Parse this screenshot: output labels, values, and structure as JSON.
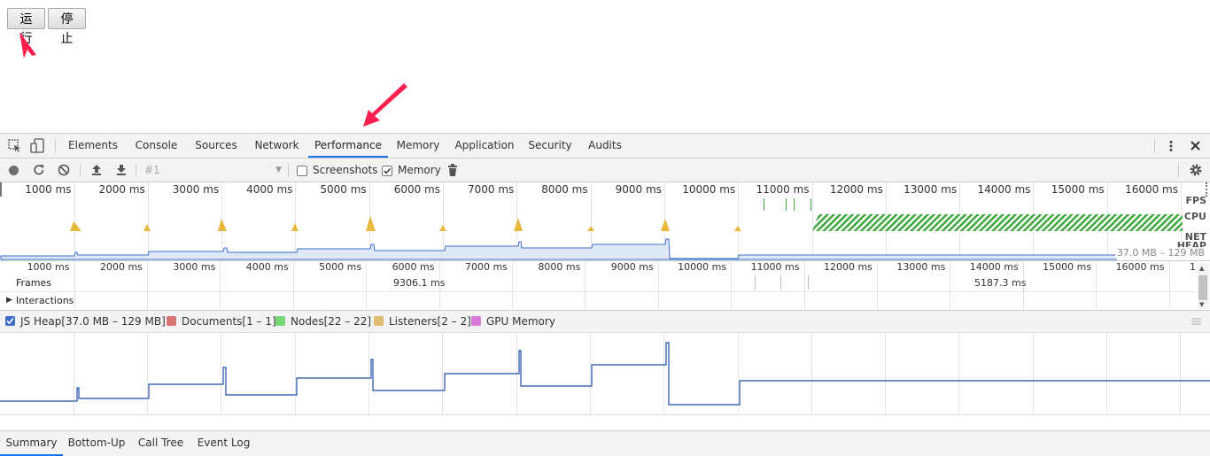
{
  "page": {
    "run_button": "运行",
    "stop_button": "停止"
  },
  "devtools": {
    "tabs": [
      "Elements",
      "Console",
      "Sources",
      "Network",
      "Performance",
      "Memory",
      "Application",
      "Security",
      "Audits"
    ],
    "active_tab": "Performance"
  },
  "toolbar": {
    "profile_select": "#1",
    "screenshots_label": "Screenshots",
    "screenshots_checked": false,
    "memory_label": "Memory",
    "memory_checked": true
  },
  "overview": {
    "ticks": [
      "1000 ms",
      "2000 ms",
      "3000 ms",
      "4000 ms",
      "5000 ms",
      "6000 ms",
      "7000 ms",
      "8000 ms",
      "9000 ms",
      "10000 ms",
      "11000 ms",
      "12000 ms",
      "13000 ms",
      "14000 ms",
      "15000 ms",
      "16000 ms"
    ],
    "labels": {
      "fps": "FPS",
      "cpu": "CPU",
      "net": "NET",
      "heap": "HEAP"
    },
    "heap_range": "37.0 MB – 129 MB"
  },
  "flamechart": {
    "ticks": [
      "1000 ms",
      "2000 ms",
      "3000 ms",
      "4000 ms",
      "5000 ms",
      "6000 ms",
      "7000 ms",
      "8000 ms",
      "9000 ms",
      "10000 ms",
      "11000 ms",
      "12000 ms",
      "13000 ms",
      "14000 ms",
      "15000 ms",
      "16000 ms",
      "1"
    ],
    "frames_label": "Frames",
    "frame_durations": [
      "9306.1 ms",
      "5187.3 ms"
    ],
    "interactions_label": "Interactions"
  },
  "legend": [
    {
      "label": "JS Heap[37.0 MB – 129 MB]",
      "color": "#3e6ec9",
      "checkbox": true
    },
    {
      "label": "Documents[1 – 1]",
      "color": "#d97474"
    },
    {
      "label": "Nodes[22 – 22]",
      "color": "#74d974"
    },
    {
      "label": "Listeners[2 – 2]",
      "color": "#e0bb72"
    },
    {
      "label": "GPU Memory",
      "color": "#d97ad9"
    }
  ],
  "bottom_tabs": [
    "Summary",
    "Bottom-Up",
    "Call Tree",
    "Event Log"
  ],
  "active_bottom_tab": "Summary",
  "colors": {
    "accent": "#1a73e8",
    "heap_line": "#1c4fa8",
    "cpu": "#e8b83c",
    "arrow": "#ff1f4f",
    "fps": "#3ea83e"
  }
}
